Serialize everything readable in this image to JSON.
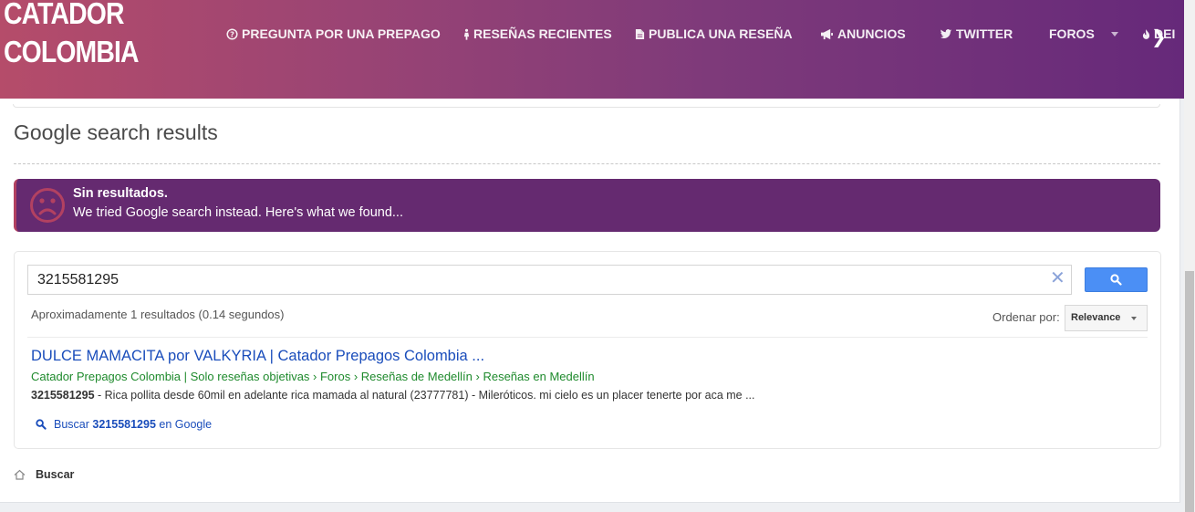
{
  "header": {
    "logo_line1": "CATADOR",
    "logo_line2": "COLOMBIA",
    "nav": [
      {
        "icon": "question-circle-icon",
        "label": "PREGUNTA POR UNA PREPAGO"
      },
      {
        "icon": "female-figure-icon",
        "label": "RESEÑAS RECIENTES"
      },
      {
        "icon": "document-icon",
        "label": "PUBLICA UNA RESEÑA"
      },
      {
        "icon": "megaphone-icon",
        "label": "ANUNCIOS"
      },
      {
        "icon": "twitter-icon",
        "label": "TWITTER"
      },
      {
        "icon": "",
        "label": "FOROS"
      },
      {
        "icon": "flame-icon",
        "label": "DEI"
      }
    ],
    "scroll_arrow": "❯"
  },
  "page": {
    "title": "Google search results"
  },
  "alert": {
    "icon": "sad-face-icon",
    "title": "Sin resultados.",
    "text": "We tried Google search instead. Here's what we found..."
  },
  "search": {
    "query": "3215581295",
    "clear_label": "✕",
    "result_count": "Aproximadamente 1 resultados (0.14 segundos)",
    "order_label": "Ordenar por:",
    "order_value": "Relevance"
  },
  "results": [
    {
      "title": "DULCE MAMACITA por VALKYRIA | Catador Prepagos Colombia ...",
      "breadcrumb": "Catador Prepagos Colombia | Solo reseñas objetivas › Foros › Reseñas de Medellín › Reseñas en Medellín",
      "snippet_bold": "3215581295",
      "snippet": " - Rica pollita desde 60mil en adelante rica mamada al natural (23777781) - Mileróticos. mi cielo es un placer tenerte por aca me ..."
    }
  ],
  "google_link": {
    "prefix": "Buscar ",
    "query": "3215581295",
    "suffix": " en Google"
  },
  "footer": {
    "home_icon": "home-icon",
    "label": "Buscar"
  },
  "colors": {
    "header_start": "#b54c6a",
    "header_end": "#66297a",
    "alert_bg": "#652a70",
    "link_blue": "#1a4dbb",
    "url_green": "#1e8a2c",
    "search_button": "#4b8ff5"
  }
}
